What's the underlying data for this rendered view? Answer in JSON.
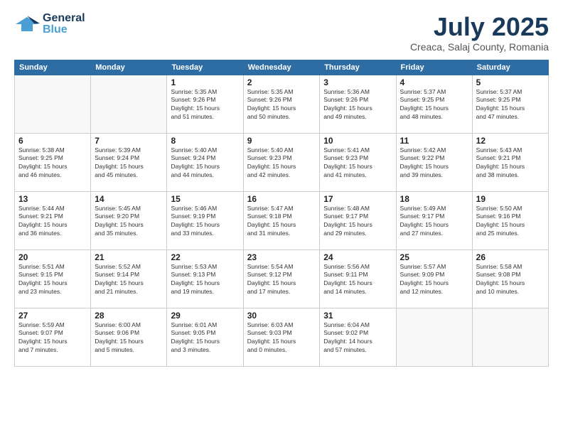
{
  "header": {
    "logo_general": "General",
    "logo_blue": "Blue",
    "main_title": "July 2025",
    "subtitle": "Creaca, Salaj County, Romania"
  },
  "days_of_week": [
    "Sunday",
    "Monday",
    "Tuesday",
    "Wednesday",
    "Thursday",
    "Friday",
    "Saturday"
  ],
  "weeks": [
    [
      {
        "day": "",
        "info": ""
      },
      {
        "day": "",
        "info": ""
      },
      {
        "day": "1",
        "info": "Sunrise: 5:35 AM\nSunset: 9:26 PM\nDaylight: 15 hours\nand 51 minutes."
      },
      {
        "day": "2",
        "info": "Sunrise: 5:35 AM\nSunset: 9:26 PM\nDaylight: 15 hours\nand 50 minutes."
      },
      {
        "day": "3",
        "info": "Sunrise: 5:36 AM\nSunset: 9:26 PM\nDaylight: 15 hours\nand 49 minutes."
      },
      {
        "day": "4",
        "info": "Sunrise: 5:37 AM\nSunset: 9:25 PM\nDaylight: 15 hours\nand 48 minutes."
      },
      {
        "day": "5",
        "info": "Sunrise: 5:37 AM\nSunset: 9:25 PM\nDaylight: 15 hours\nand 47 minutes."
      }
    ],
    [
      {
        "day": "6",
        "info": "Sunrise: 5:38 AM\nSunset: 9:25 PM\nDaylight: 15 hours\nand 46 minutes."
      },
      {
        "day": "7",
        "info": "Sunrise: 5:39 AM\nSunset: 9:24 PM\nDaylight: 15 hours\nand 45 minutes."
      },
      {
        "day": "8",
        "info": "Sunrise: 5:40 AM\nSunset: 9:24 PM\nDaylight: 15 hours\nand 44 minutes."
      },
      {
        "day": "9",
        "info": "Sunrise: 5:40 AM\nSunset: 9:23 PM\nDaylight: 15 hours\nand 42 minutes."
      },
      {
        "day": "10",
        "info": "Sunrise: 5:41 AM\nSunset: 9:23 PM\nDaylight: 15 hours\nand 41 minutes."
      },
      {
        "day": "11",
        "info": "Sunrise: 5:42 AM\nSunset: 9:22 PM\nDaylight: 15 hours\nand 39 minutes."
      },
      {
        "day": "12",
        "info": "Sunrise: 5:43 AM\nSunset: 9:21 PM\nDaylight: 15 hours\nand 38 minutes."
      }
    ],
    [
      {
        "day": "13",
        "info": "Sunrise: 5:44 AM\nSunset: 9:21 PM\nDaylight: 15 hours\nand 36 minutes."
      },
      {
        "day": "14",
        "info": "Sunrise: 5:45 AM\nSunset: 9:20 PM\nDaylight: 15 hours\nand 35 minutes."
      },
      {
        "day": "15",
        "info": "Sunrise: 5:46 AM\nSunset: 9:19 PM\nDaylight: 15 hours\nand 33 minutes."
      },
      {
        "day": "16",
        "info": "Sunrise: 5:47 AM\nSunset: 9:18 PM\nDaylight: 15 hours\nand 31 minutes."
      },
      {
        "day": "17",
        "info": "Sunrise: 5:48 AM\nSunset: 9:17 PM\nDaylight: 15 hours\nand 29 minutes."
      },
      {
        "day": "18",
        "info": "Sunrise: 5:49 AM\nSunset: 9:17 PM\nDaylight: 15 hours\nand 27 minutes."
      },
      {
        "day": "19",
        "info": "Sunrise: 5:50 AM\nSunset: 9:16 PM\nDaylight: 15 hours\nand 25 minutes."
      }
    ],
    [
      {
        "day": "20",
        "info": "Sunrise: 5:51 AM\nSunset: 9:15 PM\nDaylight: 15 hours\nand 23 minutes."
      },
      {
        "day": "21",
        "info": "Sunrise: 5:52 AM\nSunset: 9:14 PM\nDaylight: 15 hours\nand 21 minutes."
      },
      {
        "day": "22",
        "info": "Sunrise: 5:53 AM\nSunset: 9:13 PM\nDaylight: 15 hours\nand 19 minutes."
      },
      {
        "day": "23",
        "info": "Sunrise: 5:54 AM\nSunset: 9:12 PM\nDaylight: 15 hours\nand 17 minutes."
      },
      {
        "day": "24",
        "info": "Sunrise: 5:56 AM\nSunset: 9:11 PM\nDaylight: 15 hours\nand 14 minutes."
      },
      {
        "day": "25",
        "info": "Sunrise: 5:57 AM\nSunset: 9:09 PM\nDaylight: 15 hours\nand 12 minutes."
      },
      {
        "day": "26",
        "info": "Sunrise: 5:58 AM\nSunset: 9:08 PM\nDaylight: 15 hours\nand 10 minutes."
      }
    ],
    [
      {
        "day": "27",
        "info": "Sunrise: 5:59 AM\nSunset: 9:07 PM\nDaylight: 15 hours\nand 7 minutes."
      },
      {
        "day": "28",
        "info": "Sunrise: 6:00 AM\nSunset: 9:06 PM\nDaylight: 15 hours\nand 5 minutes."
      },
      {
        "day": "29",
        "info": "Sunrise: 6:01 AM\nSunset: 9:05 PM\nDaylight: 15 hours\nand 3 minutes."
      },
      {
        "day": "30",
        "info": "Sunrise: 6:03 AM\nSunset: 9:03 PM\nDaylight: 15 hours\nand 0 minutes."
      },
      {
        "day": "31",
        "info": "Sunrise: 6:04 AM\nSunset: 9:02 PM\nDaylight: 14 hours\nand 57 minutes."
      },
      {
        "day": "",
        "info": ""
      },
      {
        "day": "",
        "info": ""
      }
    ]
  ]
}
